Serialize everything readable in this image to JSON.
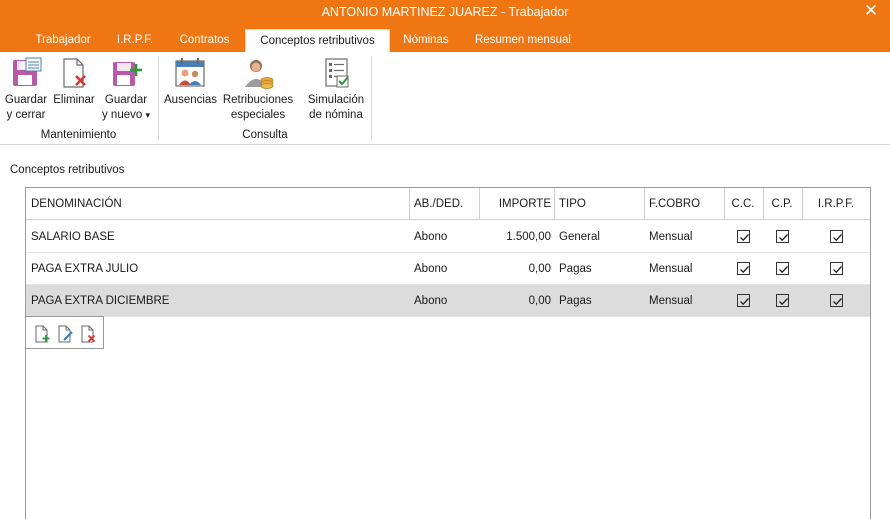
{
  "window": {
    "title": "ANTONIO MARTINEZ JUAREZ - Trabajador",
    "close_label": "✕"
  },
  "tabs": [
    {
      "label": "Trabajador"
    },
    {
      "label": "I.R.P.F."
    },
    {
      "label": "Contratos"
    },
    {
      "label": "Conceptos retributivos",
      "active": true
    },
    {
      "label": "Nóminas"
    },
    {
      "label": "Resumen mensual"
    }
  ],
  "ribbon": {
    "buttons": {
      "save_close": {
        "line1": "Guardar",
        "line2": "y cerrar",
        "icon": "save-close-icon"
      },
      "delete": {
        "line1": "Eliminar",
        "icon": "delete-document-icon"
      },
      "save_new": {
        "line1": "Guardar",
        "line2": "y nuevo",
        "dropdown": "▾",
        "icon": "save-new-icon"
      },
      "absences": {
        "line1": "Ausencias",
        "icon": "calendar-people-icon"
      },
      "special_pay": {
        "line1": "Retribuciones",
        "line2": "especiales",
        "icon": "person-coins-icon"
      },
      "payroll_sim": {
        "line1": "Simulación",
        "line2": "de nómina",
        "icon": "checklist-icon"
      }
    },
    "groups": {
      "maintenance": "Mantenimiento",
      "query": "Consulta"
    }
  },
  "section_title": "Conceptos retributivos",
  "table": {
    "headers": {
      "denominacion": "DENOMINACIÓN",
      "abded": "AB./DED.",
      "importe": "IMPORTE",
      "tipo": "TIPO",
      "fcobro": "F.COBRO",
      "cc": "C.C.",
      "cp": "C.P.",
      "irpf": "I.R.P.F."
    },
    "rows": [
      {
        "denominacion": "SALARIO BASE",
        "abded": "Abono",
        "importe": "1.500,00",
        "tipo": "General",
        "fcobro": "Mensual",
        "cc": true,
        "cp": true,
        "irpf": true
      },
      {
        "denominacion": "PAGA EXTRA JULIO",
        "abded": "Abono",
        "importe": "0,00",
        "tipo": "Pagas",
        "fcobro": "Mensual",
        "cc": true,
        "cp": true,
        "irpf": true
      },
      {
        "denominacion": "PAGA EXTRA DICIEMBRE",
        "abded": "Abono",
        "importe": "0,00",
        "tipo": "Pagas",
        "fcobro": "Mensual",
        "cc": true,
        "cp": true,
        "irpf": true,
        "selected": true
      }
    ]
  },
  "mini_toolbar": {
    "icons": [
      "add-document-icon",
      "edit-document-icon",
      "delete-document-icon"
    ]
  },
  "colors": {
    "accent": "#ef7613",
    "selected_row": "#dcdcdc"
  }
}
